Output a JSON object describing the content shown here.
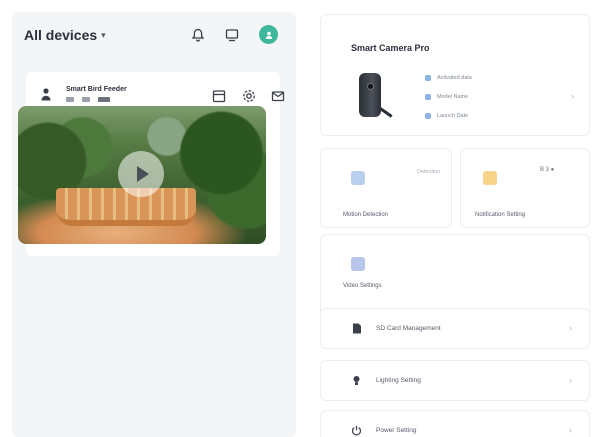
{
  "left": {
    "title": "All devices",
    "device": {
      "name": "Smart Bird Feeder"
    }
  },
  "right": {
    "camera": {
      "title": "Smart Camera Pro",
      "info": [
        "Activated data",
        "Model Name",
        "Launch Date"
      ]
    },
    "tiles": {
      "motion": {
        "label": "Motion Detection",
        "status": "Detection"
      },
      "notification": {
        "label": "Notification Setting",
        "status": "B 3 ●"
      },
      "video": {
        "label": "Video Settings"
      }
    },
    "rows": [
      {
        "label": "SD Card Management"
      },
      {
        "label": "Lighting Setting"
      },
      {
        "label": "Power Setting"
      }
    ]
  },
  "colors": {
    "accent_green": "#3fb79a",
    "panel_bg": "#f3f5f7",
    "info_blue": "#8ab4e6"
  }
}
